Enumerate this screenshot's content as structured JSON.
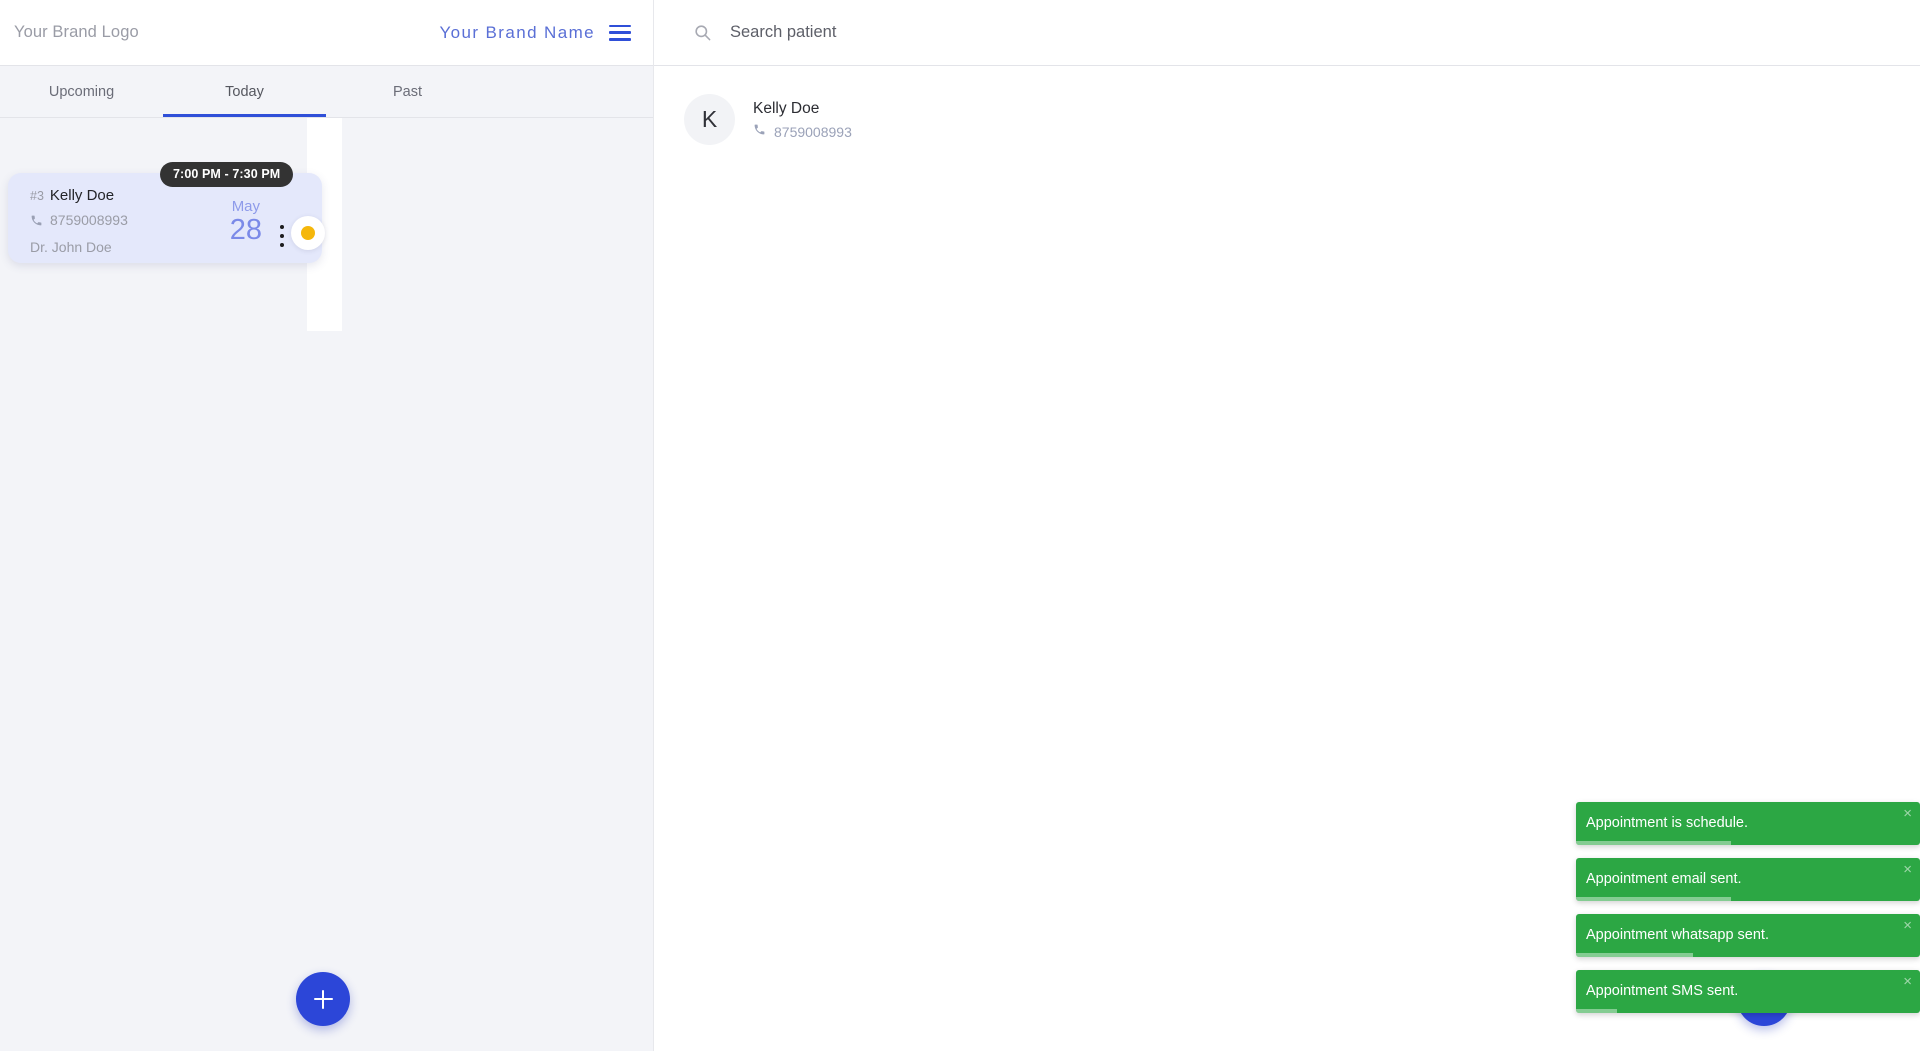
{
  "left_panel": {
    "header": {
      "logo_text": "Your Brand Logo",
      "brand_name": "Your Brand Name",
      "menu_icon": "hamburger-icon"
    },
    "tabs": [
      {
        "label": "Upcoming",
        "active": false
      },
      {
        "label": "Today",
        "active": true
      },
      {
        "label": "Past",
        "active": false
      }
    ],
    "appointment_card": {
      "time_range": "7:00 PM - 7:30 PM",
      "number": "#3",
      "patient_name": "Kelly Doe",
      "phone": "8759008993",
      "phone_icon": "phone-icon",
      "doctor": "Dr. John Doe",
      "month": "May",
      "day": "28",
      "menu_icon": "kebab-menu-icon",
      "status_color": "#f5b70b"
    },
    "add_button_label": "+"
  },
  "right_panel": {
    "search": {
      "placeholder": "Search patient",
      "value": "",
      "icon": "search-icon"
    },
    "patients": [
      {
        "initial": "K",
        "name": "Kelly Doe",
        "phone": "8759008993",
        "phone_icon": "phone-icon"
      }
    ],
    "add_button_label": "+"
  },
  "toasts": {
    "close_label": "×",
    "accent_color": "#2ca744",
    "items": [
      {
        "message": "Appointment is schedule.",
        "progress": 45
      },
      {
        "message": "Appointment email sent.",
        "progress": 45
      },
      {
        "message": "Appointment whatsapp sent.",
        "progress": 34
      },
      {
        "message": "Appointment SMS sent.",
        "progress": 12
      }
    ]
  },
  "theme": {
    "brand_blue": "#2f4fd8",
    "card_bg": "#e4e8fb",
    "panel_bg": "#f3f4f8",
    "toast_green": "#2ca744"
  }
}
